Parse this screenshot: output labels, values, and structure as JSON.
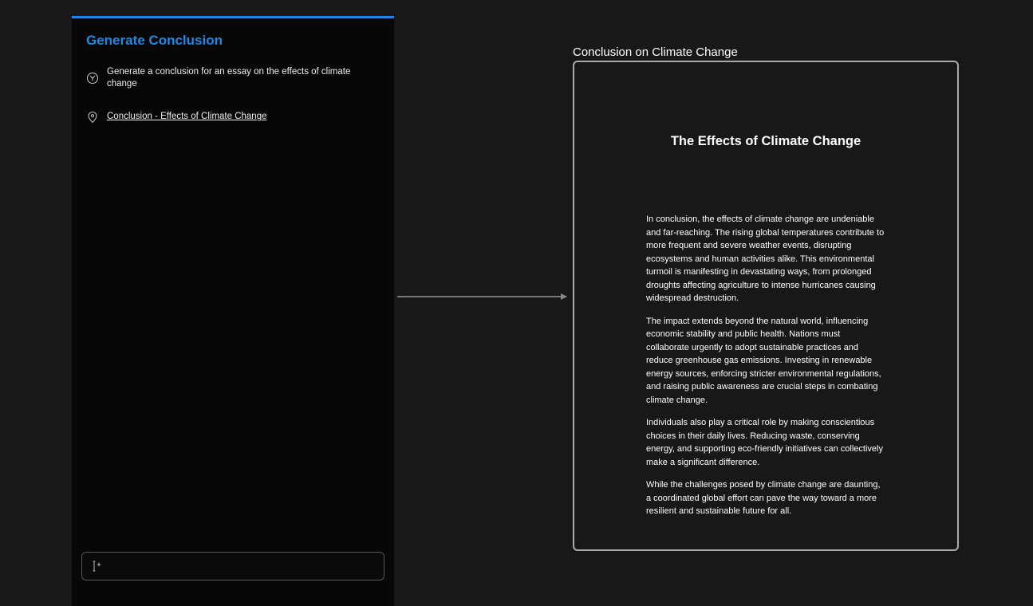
{
  "leftPanel": {
    "title": "Generate Conclusion",
    "rows": [
      {
        "icon": "y-circle-icon",
        "text": "Generate a conclusion for an essay on the effects of climate change",
        "underlined": false
      },
      {
        "icon": "pin-icon",
        "text": "Conclusion - Effects of Climate Change",
        "underlined": true
      }
    ],
    "inputPlaceholder": ""
  },
  "rightBlock": {
    "title": "Conclusion on Climate Change",
    "docTitle": "The Effects of Climate Change",
    "paragraphs": [
      "In conclusion, the effects of climate change are undeniable and far-reaching. The rising global temperatures contribute to more frequent and severe weather events, disrupting ecosystems and human activities alike. This environmental turmoil is manifesting in devastating ways, from prolonged droughts affecting agriculture to intense hurricanes causing widespread destruction.",
      "The impact extends beyond the natural world, influencing economic stability and public health. Nations must collaborate urgently to adopt sustainable practices and reduce greenhouse gas emissions. Investing in renewable energy sources, enforcing stricter environmental regulations, and raising public awareness are crucial steps in combating climate change.",
      "Individuals also play a critical role by making conscientious choices in their daily lives. Reducing waste, conserving energy, and supporting eco-friendly initiatives can collectively make a significant difference.",
      "While the challenges posed by climate change are daunting, a coordinated global effort can pave the way toward a more resilient and sustainable future for all."
    ]
  }
}
